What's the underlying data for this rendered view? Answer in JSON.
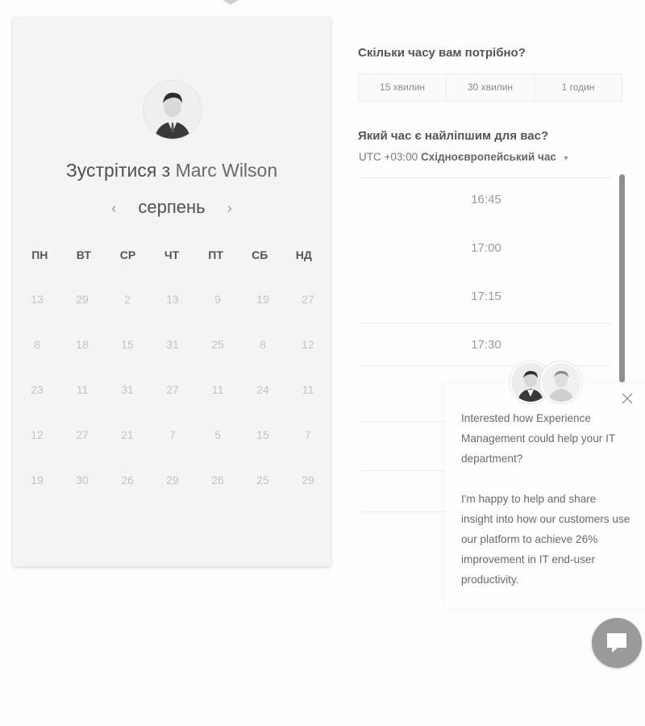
{
  "meeting": {
    "prefix": "Зустрітися з",
    "name": "Marc Wilson"
  },
  "calendar": {
    "month": "серпень",
    "prev_icon": "‹",
    "next_icon": "›",
    "weekdays": [
      "ПН",
      "ВТ",
      "СР",
      "ЧТ",
      "ПТ",
      "СБ",
      "НД"
    ],
    "weeks": [
      [
        "13",
        "29",
        "2",
        "13",
        "9",
        "19",
        "27"
      ],
      [
        "8",
        "18",
        "15",
        "31",
        "25",
        "8",
        "12"
      ],
      [
        "23",
        "11",
        "31",
        "27",
        "11",
        "24",
        "11"
      ],
      [
        "12",
        "27",
        "21",
        "7",
        "5",
        "15",
        "7"
      ],
      [
        "19",
        "30",
        "26",
        "29",
        "26",
        "25",
        "29"
      ]
    ]
  },
  "duration": {
    "question": "Скільки часу вам потрібно?",
    "options": [
      "15 хвилин",
      "30 хвилин",
      "1 годин"
    ]
  },
  "time": {
    "question": "Який час є найліпшим для вас?",
    "tz_offset": "UTC +03:00",
    "tz_name": "Східноєвропейський час",
    "slots": [
      "16:45",
      "17:00",
      "17:15",
      "17:30"
    ]
  },
  "chat": {
    "message_1": "Interested how Experience Management could help your IT department?",
    "message_2": "I'm happy to help and share insight into how our customers use our platform to achieve 26% improvement in IT end-user productivity."
  },
  "icons": {
    "close": "close-icon",
    "chat": "chat-bubble-icon",
    "caret": "caret-down-icon"
  }
}
